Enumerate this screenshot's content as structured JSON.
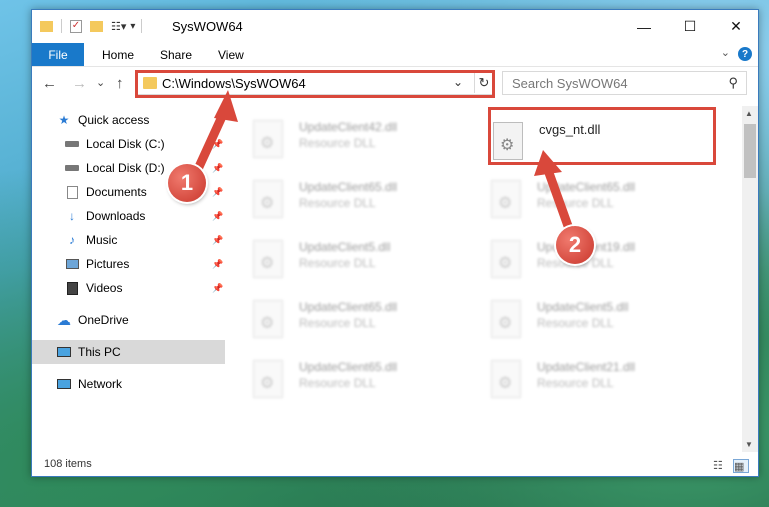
{
  "window": {
    "title": "SysWOW64",
    "controls": {
      "minimize": "—",
      "maximize": "☐",
      "close": "✕"
    }
  },
  "ribbon": {
    "tabs": [
      "File",
      "Home",
      "Share",
      "View"
    ],
    "help": "?"
  },
  "nav": {
    "back": "←",
    "forward": "→",
    "recent": "⌄",
    "up": "↑",
    "address": "C:\\Windows\\SysWOW64",
    "refresh": "↻",
    "search_placeholder": "Search SysWOW64"
  },
  "sidebar": {
    "items": [
      {
        "label": "Quick access",
        "icon": "star-icon",
        "pinned": false
      },
      {
        "label": "Local Disk (C:)",
        "icon": "drive-icon",
        "pinned": true
      },
      {
        "label": "Local Disk (D:)",
        "icon": "drive-icon",
        "pinned": true
      },
      {
        "label": "Documents",
        "icon": "documents-icon",
        "pinned": true
      },
      {
        "label": "Downloads",
        "icon": "downloads-icon",
        "pinned": true
      },
      {
        "label": "Music",
        "icon": "music-icon",
        "pinned": true
      },
      {
        "label": "Pictures",
        "icon": "pictures-icon",
        "pinned": true
      },
      {
        "label": "Videos",
        "icon": "videos-icon",
        "pinned": true
      },
      {
        "label": "OneDrive",
        "icon": "onedrive-icon",
        "pinned": false
      },
      {
        "label": "This PC",
        "icon": "pc-icon",
        "pinned": false,
        "selected": true
      },
      {
        "label": "Network",
        "icon": "network-icon",
        "pinned": false
      }
    ]
  },
  "files": {
    "left": [
      {
        "name": "UpdateClient42.dll",
        "type": "Resource DLL"
      },
      {
        "name": "UpdateClient65.dll",
        "type": "Resource DLL"
      },
      {
        "name": "UpdateClient5.dll",
        "type": "Resource DLL"
      },
      {
        "name": "UpdateClient65.dll",
        "type": "Resource DLL"
      },
      {
        "name": "UpdateClient65.dll",
        "type": "Resource DLL"
      }
    ],
    "right": [
      {
        "name": "cvgs_nt.dll",
        "type": ""
      },
      {
        "name": "UpdateClient65.dll",
        "type": "Resource DLL"
      },
      {
        "name": "UpdateClient19.dll",
        "type": "Resource DLL"
      },
      {
        "name": "UpdateClient5.dll",
        "type": "Resource DLL"
      },
      {
        "name": "UpdateClient21.dll",
        "type": "Resource DLL"
      }
    ]
  },
  "status": {
    "item_count": "108 items"
  },
  "callouts": {
    "one": "1",
    "two": "2"
  },
  "colors": {
    "accent": "#1979ca",
    "highlight": "#d9483b",
    "selected": "#d9d9d9"
  }
}
